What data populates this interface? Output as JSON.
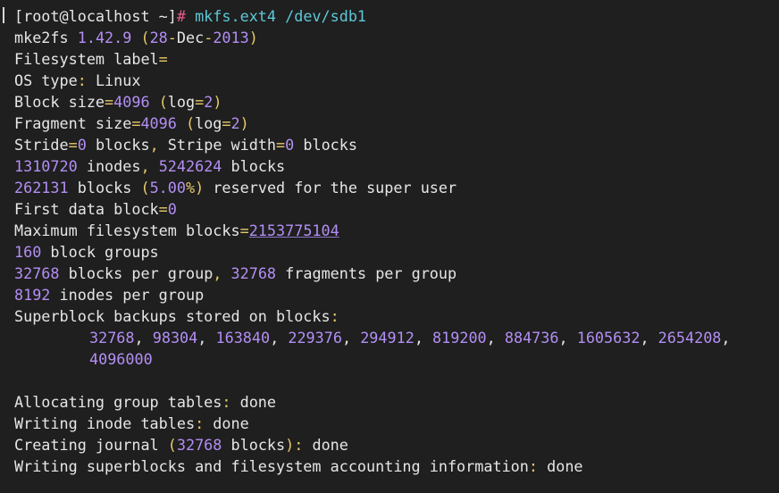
{
  "prompt": {
    "user_host": "[root@localhost ~]",
    "hash": "#",
    "command": "mkfs.ext4 /dev/sdb1"
  },
  "output": {
    "version": {
      "name": "mke2fs",
      "number": "1.42.9",
      "date_day": "28",
      "date_month": "Dec",
      "date_year": "2013"
    },
    "label_line": "Filesystem label",
    "os_type": {
      "label": "OS type",
      "value": "Linux"
    },
    "block_size": {
      "label": "Block size",
      "value": "4096",
      "log_label": "log",
      "log_value": "2"
    },
    "fragment_size": {
      "label": "Fragment size",
      "value": "4096",
      "log_label": "log",
      "log_value": "2"
    },
    "stride": {
      "label": "Stride",
      "value": "0",
      "unit": "blocks",
      "stripe_label": "Stripe width",
      "stripe_value": "0"
    },
    "inodes_blocks": {
      "inodes": "1310720",
      "inodes_label": "inodes",
      "blocks": "5242624",
      "blocks_label": "blocks"
    },
    "reserved": {
      "blocks": "262131",
      "blocks_label": "blocks",
      "percent": "5.00",
      "text": "reserved for the super user"
    },
    "first_data_block": {
      "label": "First data block",
      "value": "0"
    },
    "max_fs_blocks": {
      "label": "Maximum filesystem blocks",
      "value": "2153775104"
    },
    "block_groups": {
      "value": "160",
      "label": "block groups"
    },
    "per_group": {
      "blocks": "32768",
      "blocks_label": "blocks per group",
      "fragments": "32768",
      "fragments_label": "fragments per group"
    },
    "inodes_per_group": {
      "value": "8192",
      "label": "inodes per group"
    },
    "superblock_backups": {
      "label": "Superblock backups stored on blocks",
      "values": [
        "32768",
        "98304",
        "163840",
        "229376",
        "294912",
        "819200",
        "884736",
        "1605632",
        "2654208",
        "4096000"
      ]
    },
    "allocating": {
      "label": "Allocating group tables",
      "status": "done"
    },
    "writing_inode": {
      "label": "Writing inode tables",
      "status": "done"
    },
    "creating_journal": {
      "label": "Creating journal",
      "blocks": "32768",
      "blocks_label": "blocks",
      "status": "done"
    },
    "writing_superblocks": {
      "label": "Writing superblocks and filesystem accounting information",
      "status": "done"
    }
  }
}
